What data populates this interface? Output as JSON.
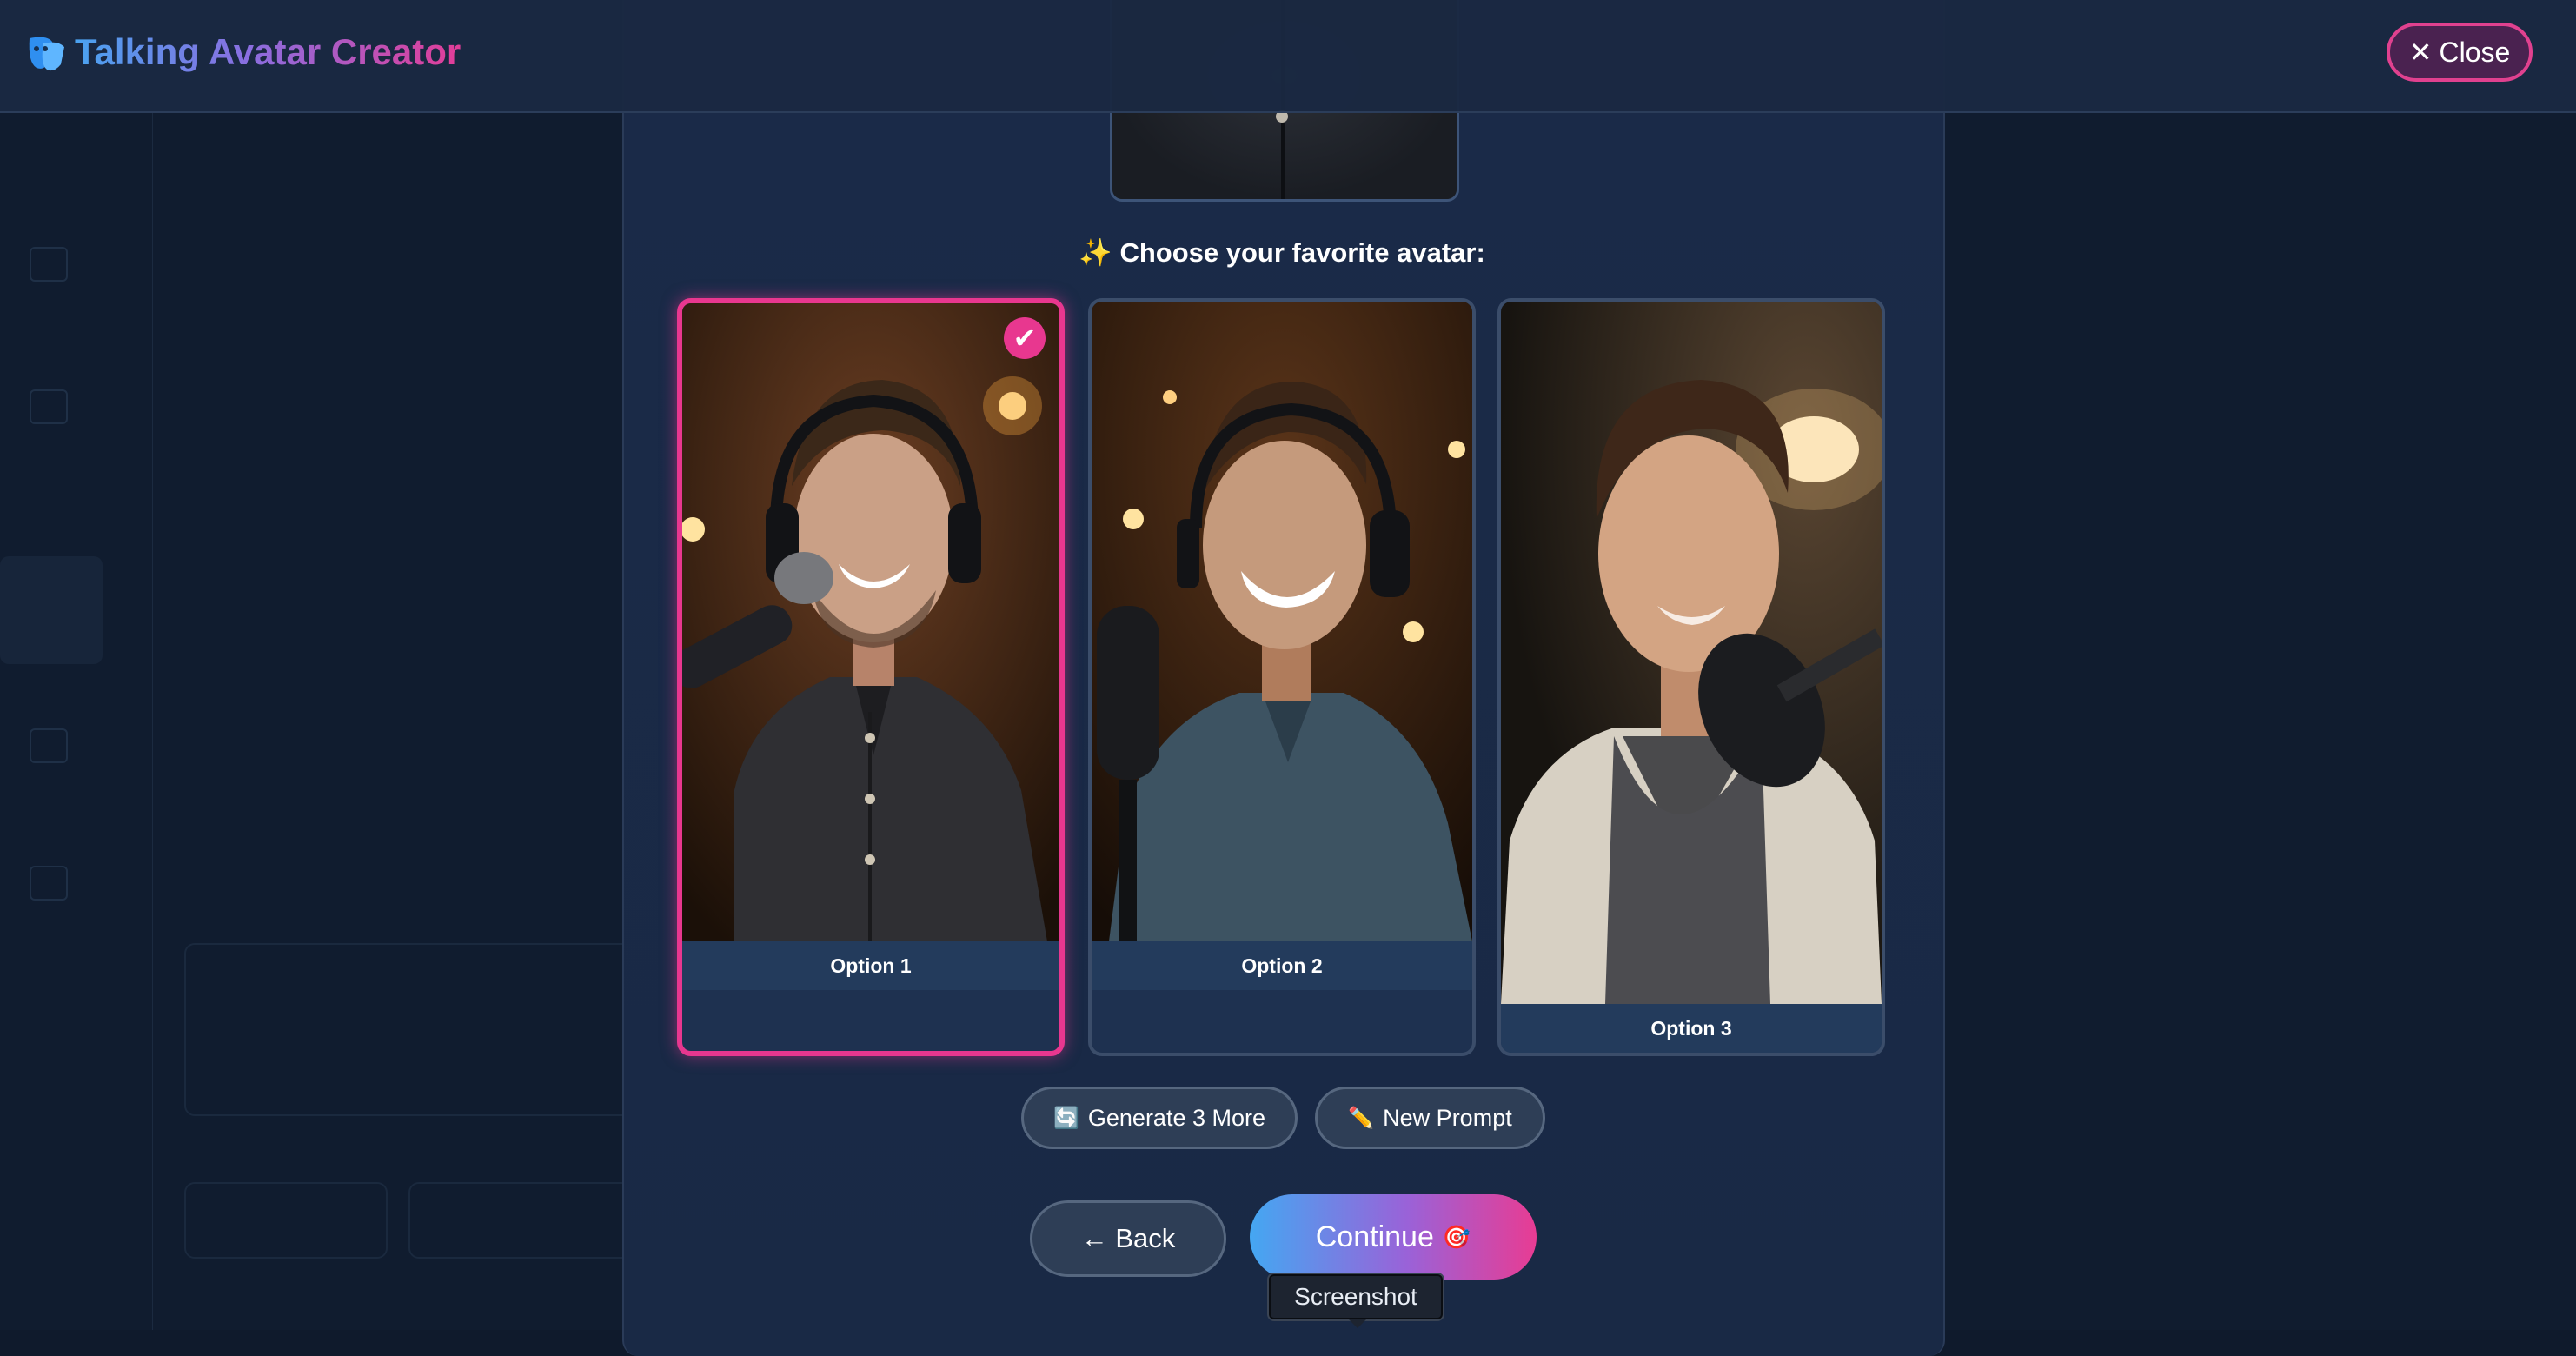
{
  "header": {
    "title": "Talking Avatar Creator",
    "close_label": "Close"
  },
  "picker": {
    "heading": "Choose your favorite avatar:",
    "heading_icon": "sparkles-icon",
    "options": [
      {
        "label": "Option 1",
        "selected": true
      },
      {
        "label": "Option 2",
        "selected": false
      },
      {
        "label": "Option 3",
        "selected": false
      }
    ]
  },
  "actions": {
    "generate_more_label": "Generate 3 More",
    "new_prompt_label": "New Prompt",
    "back_label": "← Back",
    "continue_label": "Continue"
  },
  "tooltip": {
    "text": "Screenshot"
  },
  "colors": {
    "accent_pink": "#e8378f",
    "accent_blue": "#44a7f2",
    "modal_bg": "#1a2a48",
    "page_bg": "#101c2f"
  }
}
